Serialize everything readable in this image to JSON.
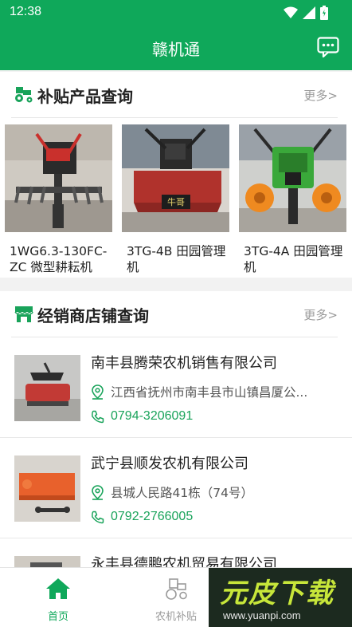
{
  "status_bar": {
    "time": "12:38"
  },
  "app_bar": {
    "title": "赣机通"
  },
  "products_section": {
    "title": "补贴产品查询",
    "more": "更多>",
    "items": [
      {
        "name": "1WG6.3-130FC-ZC 微型耕耘机"
      },
      {
        "name": "3TG-4B 田园管理机"
      },
      {
        "name": "3TG-4A 田园管理机"
      }
    ]
  },
  "shops_section": {
    "title": "经销商店铺查询",
    "more": "更多>",
    "items": [
      {
        "name": "南丰县腾荣农机销售有限公司",
        "address": "江西省抚州市南丰县市山镇昌厦公...",
        "phone": "0794-3206091"
      },
      {
        "name": "武宁县顺发农机有限公司",
        "address": "县城人民路41栋（74号）",
        "phone": "0792-2766005"
      },
      {
        "name": "永丰县德鹏农机贸易有限公司"
      }
    ]
  },
  "tabbar": {
    "tabs": [
      {
        "label": "首页",
        "icon": "home-icon",
        "active": true
      },
      {
        "label": "农机补贴",
        "icon": "tractor-icon",
        "active": false
      }
    ]
  },
  "watermark": {
    "text": "元皮下载",
    "url": "www.yuanpi.com"
  },
  "colors": {
    "primary": "#0fa85a",
    "phone": "#19a35a",
    "muted": "#9a9a9a"
  }
}
